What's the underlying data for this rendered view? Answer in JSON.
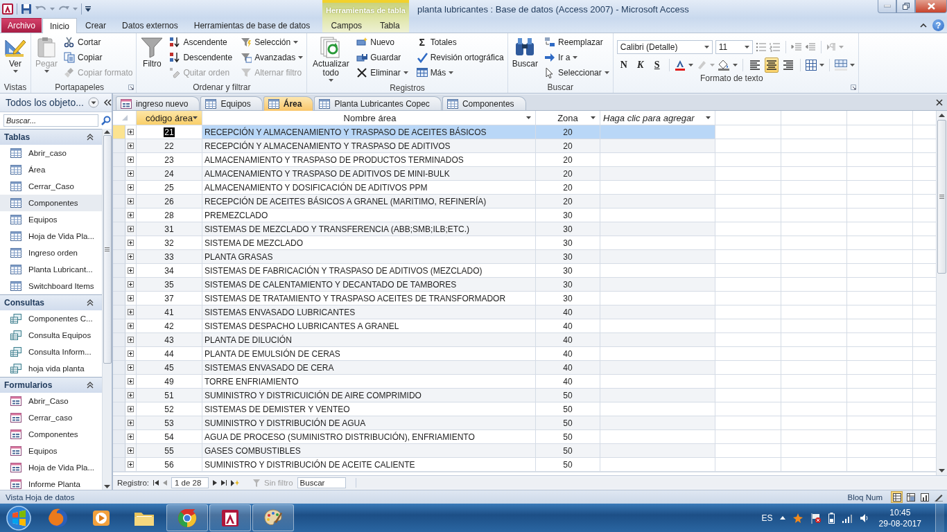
{
  "window": {
    "title": "planta lubricantes : Base de datos (Access 2007) - Microsoft Access",
    "context_label": "Herramientas de tabla",
    "help_glyph": "?"
  },
  "ribbon_tabs": [
    {
      "label": "Archivo",
      "kind": "file",
      "selected": false
    },
    {
      "label": "Inicio",
      "kind": "tab",
      "selected": true
    },
    {
      "label": "Crear",
      "kind": "tab",
      "selected": false
    },
    {
      "label": "Datos externos",
      "kind": "tab",
      "selected": false
    },
    {
      "label": "Herramientas de base de datos",
      "kind": "tab",
      "selected": false
    },
    {
      "label": "Campos",
      "kind": "context",
      "selected": false
    },
    {
      "label": "Tabla",
      "kind": "context",
      "selected": false
    }
  ],
  "ribbon_groups": [
    {
      "label": "Vistas",
      "kind": "buttons",
      "launcher": false,
      "items": [
        {
          "kind": "large",
          "label": "Ver",
          "dropdown": true,
          "disabled": false
        }
      ]
    },
    {
      "label": "Portapapeles",
      "kind": "buttons",
      "launcher": true,
      "items": [
        {
          "kind": "large",
          "label": "Pegar",
          "dropdown": true,
          "disabled": true
        },
        {
          "kind": "small",
          "label": "Cortar",
          "dropdown": false,
          "disabled": false
        },
        {
          "kind": "small",
          "label": "Copiar",
          "dropdown": false,
          "disabled": false
        },
        {
          "kind": "small",
          "label": "Copiar formato",
          "dropdown": false,
          "disabled": true
        }
      ]
    },
    {
      "label": "Ordenar y filtrar",
      "kind": "buttons",
      "launcher": false,
      "items": [
        {
          "kind": "large",
          "label": "Filtro",
          "dropdown": false,
          "disabled": false
        },
        {
          "kind": "small",
          "label": "Ascendente",
          "dropdown": false,
          "disabled": false
        },
        {
          "kind": "small",
          "label": "Descendente",
          "dropdown": false,
          "disabled": false
        },
        {
          "kind": "small",
          "label": "Quitar orden",
          "dropdown": false,
          "disabled": true
        },
        {
          "kind": "small",
          "label": "Selección",
          "dropdown": true,
          "disabled": false
        },
        {
          "kind": "small",
          "label": "Avanzadas",
          "dropdown": true,
          "disabled": false
        },
        {
          "kind": "small",
          "label": "Alternar filtro",
          "dropdown": false,
          "disabled": true
        }
      ]
    },
    {
      "label": "Registros",
      "kind": "buttons",
      "launcher": false,
      "items": [
        {
          "kind": "large",
          "label": "Actualizar todo",
          "dropdown": true,
          "disabled": false
        },
        {
          "kind": "small",
          "label": "Nuevo",
          "dropdown": false,
          "disabled": false
        },
        {
          "kind": "small",
          "label": "Guardar",
          "dropdown": false,
          "disabled": false
        },
        {
          "kind": "small",
          "label": "Eliminar",
          "dropdown": true,
          "disabled": false
        },
        {
          "kind": "small",
          "label": "Totales",
          "glyph": "Σ",
          "dropdown": false,
          "disabled": false
        },
        {
          "kind": "small",
          "label": "Revisión ortográfica",
          "dropdown": false,
          "disabled": false
        },
        {
          "kind": "small",
          "label": "Más",
          "dropdown": true,
          "disabled": false
        }
      ]
    },
    {
      "label": "Buscar",
      "kind": "buttons",
      "launcher": false,
      "items": [
        {
          "kind": "large",
          "label": "Buscar",
          "dropdown": false,
          "disabled": false
        },
        {
          "kind": "small",
          "label": "Reemplazar",
          "dropdown": false,
          "disabled": false
        },
        {
          "kind": "small",
          "label": "Ir a",
          "dropdown": true,
          "disabled": false
        },
        {
          "kind": "small",
          "label": "Seleccionar",
          "dropdown": true,
          "disabled": false
        }
      ]
    },
    {
      "label": "Formato de texto",
      "kind": "font",
      "launcher": true,
      "font": "Calibri (Detalle)",
      "size": "11",
      "styles": [
        "N",
        "K",
        "S"
      ],
      "alignment": [
        {
          "selected": false
        },
        {
          "selected": true
        },
        {
          "selected": false
        }
      ]
    }
  ],
  "nav_pane": {
    "title": "Todos los objeto...",
    "search_placeholder": "Buscar...",
    "groups": [
      {
        "title": "Tablas",
        "kind": "table",
        "items": [
          {
            "label": "Abrir_caso",
            "selected": false
          },
          {
            "label": "Área",
            "selected": false
          },
          {
            "label": "Cerrar_Caso",
            "selected": false
          },
          {
            "label": "Componentes",
            "selected": true
          },
          {
            "label": "Equipos",
            "selected": false
          },
          {
            "label": "Hoja de Vida Pla...",
            "selected": false
          },
          {
            "label": "Ingreso orden",
            "selected": false
          },
          {
            "label": "Planta Lubricant...",
            "selected": false
          },
          {
            "label": "Switchboard Items",
            "selected": false
          }
        ]
      },
      {
        "title": "Consultas",
        "kind": "query",
        "items": [
          {
            "label": "Componentes C...",
            "selected": false
          },
          {
            "label": "Consulta Equipos",
            "selected": false
          },
          {
            "label": "Consulta Inform...",
            "selected": false
          },
          {
            "label": "hoja vida planta",
            "selected": false
          }
        ]
      },
      {
        "title": "Formularios",
        "kind": "form",
        "items": [
          {
            "label": "Abrir_Caso",
            "selected": false
          },
          {
            "label": "Cerrar_caso",
            "selected": false
          },
          {
            "label": "Componentes",
            "selected": false
          },
          {
            "label": "Equipos",
            "selected": false
          },
          {
            "label": "Hoja de Vida Pla...",
            "selected": false
          },
          {
            "label": "Informe Planta",
            "selected": false
          }
        ]
      }
    ]
  },
  "doc_tabs": [
    {
      "label": "ingreso nuevo",
      "kind": "form",
      "selected": false
    },
    {
      "label": "Equipos",
      "kind": "table",
      "selected": false
    },
    {
      "label": "Área",
      "kind": "table",
      "selected": true
    },
    {
      "label": "Planta Lubricantes Copec",
      "kind": "table",
      "selected": false
    },
    {
      "label": "Componentes",
      "kind": "table",
      "selected": false
    }
  ],
  "table": {
    "columns": [
      {
        "label": "código área",
        "kind": "field",
        "selected": true
      },
      {
        "label": "Nombre área",
        "kind": "field",
        "selected": false
      },
      {
        "label": "Zona",
        "kind": "field",
        "selected": false
      },
      {
        "label": "Haga clic para agregar",
        "kind": "add",
        "selected": false
      }
    ],
    "rows": [
      {
        "code": "21",
        "name": "RECEPCIÓN Y ALMACENAMIENTO Y TRASPASO DE ACEITES BÁSICOS",
        "zone": "20",
        "selected": true
      },
      {
        "code": "22",
        "name": "RECEPCIÓN Y ALMACENAMIENTO Y TRASPASO DE ADITIVOS",
        "zone": "20",
        "selected": false
      },
      {
        "code": "23",
        "name": "ALMACENAMIENTO Y TRASPASO DE PRODUCTOS TERMINADOS",
        "zone": "20",
        "selected": false
      },
      {
        "code": "24",
        "name": "ALMACENAMIENTO Y TRASPASO DE ADITIVOS DE MINI-BULK",
        "zone": "20",
        "selected": false
      },
      {
        "code": "25",
        "name": "ALMACENAMIENTO Y DOSIFICACIÓN DE ADITIVOS PPM",
        "zone": "20",
        "selected": false
      },
      {
        "code": "26",
        "name": "RECEPCIÓN DE ACEITES BÁSICOS A GRANEL (MARITIMO, REFINERÍA)",
        "zone": "20",
        "selected": false
      },
      {
        "code": "28",
        "name": "PREMEZCLADO",
        "zone": "30",
        "selected": false
      },
      {
        "code": "31",
        "name": "SISTEMAS DE MEZCLADO Y TRANSFERENCIA (ABB;SMB;ILB;ETC.)",
        "zone": "30",
        "selected": false
      },
      {
        "code": "32",
        "name": "SISTEMA DE MEZCLADO",
        "zone": "30",
        "selected": false
      },
      {
        "code": "33",
        "name": "PLANTA GRASAS",
        "zone": "30",
        "selected": false
      },
      {
        "code": "34",
        "name": "SISTEMAS DE FABRICACIÓN Y TRASPASO DE ADITIVOS (MEZCLADO)",
        "zone": "30",
        "selected": false
      },
      {
        "code": "35",
        "name": "SISTEMAS DE CALENTAMIENTO Y DECANTADO DE TAMBORES",
        "zone": "30",
        "selected": false
      },
      {
        "code": "37",
        "name": "SISTEMAS DE TRATAMIENTO Y TRASPASO ACEITES DE TRANSFORMADOR",
        "zone": "30",
        "selected": false
      },
      {
        "code": "41",
        "name": "SISTEMAS ENVASADO LUBRICANTES",
        "zone": "40",
        "selected": false
      },
      {
        "code": "42",
        "name": "SISTEMAS DESPACHO LUBRICANTES A GRANEL",
        "zone": "40",
        "selected": false
      },
      {
        "code": "43",
        "name": "PLANTA DE DILUCIÓN",
        "zone": "40",
        "selected": false
      },
      {
        "code": "44",
        "name": "PLANTA DE EMULSIÓN DE CERAS",
        "zone": "40",
        "selected": false
      },
      {
        "code": "45",
        "name": "SISTEMAS ENVASADO DE CERA",
        "zone": "40",
        "selected": false
      },
      {
        "code": "49",
        "name": "TORRE ENFRIAMIENTO",
        "zone": "40",
        "selected": false
      },
      {
        "code": "51",
        "name": "SUMINISTRO Y DISTRICUICIÓN DE AIRE COMPRIMIDO",
        "zone": "50",
        "selected": false
      },
      {
        "code": "52",
        "name": "SISTEMAS DE DEMISTER Y VENTEO",
        "zone": "50",
        "selected": false
      },
      {
        "code": "53",
        "name": "SUMINISTRO Y DISTRIBUCIÓN DE AGUA",
        "zone": "50",
        "selected": false
      },
      {
        "code": "54",
        "name": "AGUA DE PROCESO (SUMINISTRO DISTRIBUCIÓN), ENFRIAMIENTO",
        "zone": "50",
        "selected": false
      },
      {
        "code": "55",
        "name": "GASES COMBUSTIBLES",
        "zone": "50",
        "selected": false
      },
      {
        "code": "56",
        "name": "SUMINISTRO Y DISTRIBUCIÓN DE ACEITE CALIENTE",
        "zone": "50",
        "selected": false
      }
    ]
  },
  "record_nav": {
    "label": "Registro:",
    "position": "1 de 28",
    "filter": "Sin filtro",
    "filter_disabled": true,
    "search_placeholder": "Buscar"
  },
  "status_bar": {
    "text": "Vista Hoja de datos",
    "indicator": "Bloq Num",
    "views": [
      {
        "selected": true
      },
      {
        "selected": false
      },
      {
        "selected": false
      },
      {
        "selected": false
      }
    ]
  },
  "taskbar": {
    "apps": [
      {
        "kind": "fox",
        "running": false
      },
      {
        "kind": "player",
        "running": false
      },
      {
        "kind": "folder",
        "running": false
      },
      {
        "kind": "wheel",
        "running": true
      },
      {
        "kind": "database",
        "running": true
      },
      {
        "kind": "palette",
        "running": true
      }
    ],
    "language": "ES",
    "time": "10:45",
    "date": "29-08-2017"
  }
}
